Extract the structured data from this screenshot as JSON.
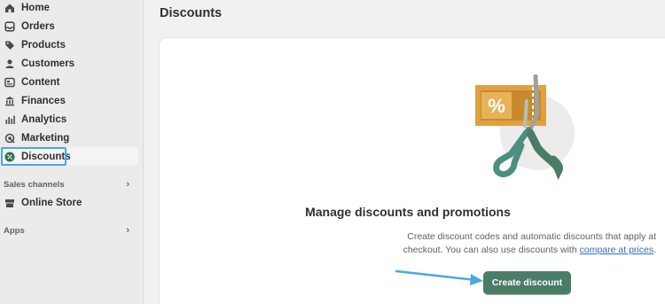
{
  "sidebar": {
    "items": [
      {
        "label": "Home",
        "icon": "home-icon"
      },
      {
        "label": "Orders",
        "icon": "orders-icon"
      },
      {
        "label": "Products",
        "icon": "tag-icon"
      },
      {
        "label": "Customers",
        "icon": "person-icon"
      },
      {
        "label": "Content",
        "icon": "content-icon"
      },
      {
        "label": "Finances",
        "icon": "bank-icon"
      },
      {
        "label": "Analytics",
        "icon": "bar-chart-icon"
      },
      {
        "label": "Marketing",
        "icon": "target-icon"
      },
      {
        "label": "Discounts",
        "icon": "discount-icon",
        "active": true
      }
    ],
    "sales_channels": {
      "label": "Sales channels",
      "items": [
        {
          "label": "Online Store",
          "icon": "store-icon"
        }
      ]
    },
    "apps": {
      "label": "Apps"
    }
  },
  "page": {
    "title": "Discounts"
  },
  "empty_state": {
    "heading": "Manage discounts and promotions",
    "text_line1": "Create discount codes and automatic discounts that apply at",
    "text_line2": "checkout. You can also use discounts with",
    "link": "compare at prices",
    "text_end": ".",
    "illustration_symbol": "%",
    "button": "Create discount"
  },
  "colors": {
    "primary_button": "#4b7d66",
    "link": "#2c6ecb",
    "annotation": "#4aa8e3",
    "coupon": "#e0a042"
  }
}
